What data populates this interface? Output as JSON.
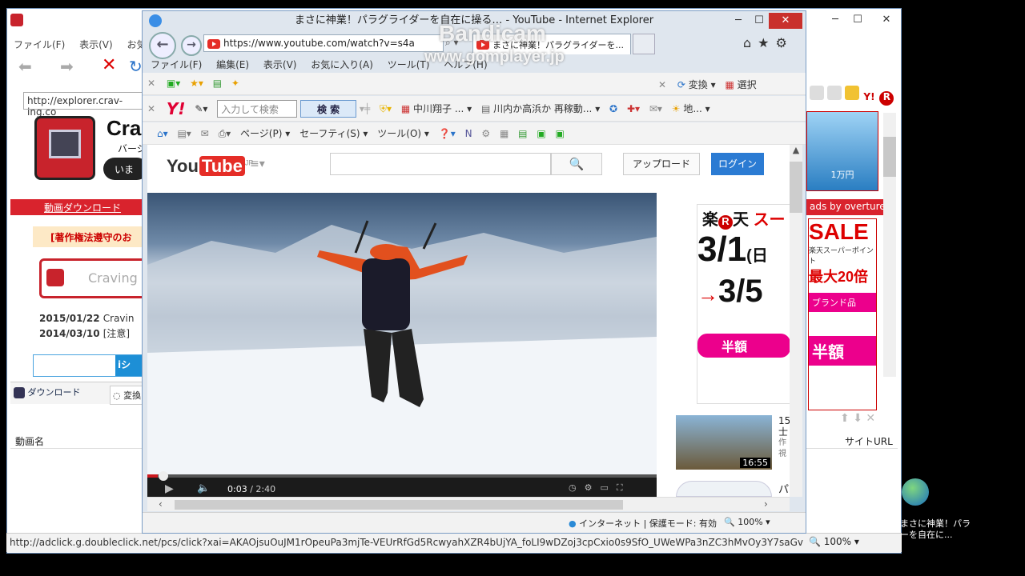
{
  "background_window": {
    "menu": [
      "ファイル(F)",
      "表示(V)",
      "お気に"
    ],
    "address": "http://explorer.crav-ing.co",
    "brand": "Cra",
    "subtext": "バージ",
    "pill": "いま",
    "download_bar": "動画ダウンロード",
    "copyright_notice": "[著作権法遵守のお",
    "craving_input": "Craving",
    "news": [
      {
        "date": "2015/01/22",
        "text": "Cravin"
      },
      {
        "date": "2014/03/10",
        "text": "[注意]"
      }
    ],
    "tabs": [
      "ダウンロード",
      "変換"
    ],
    "table_headers": [
      "動画名",
      "サイトURL"
    ],
    "ads_label": "ads by overture",
    "right_ad": {
      "big": "SALE",
      "sub": "楽天スーパーポイント",
      "max": "最大20倍",
      "brand": "ブランド品",
      "half": "半額"
    },
    "status_url": "http://adclick.g.doubleclick.net/pcs/click?xai=AKAOjsuOuJM1rOpeuPa3mjTe-VEUrRfGd5RcwyahXZR4bUjYA_foLI9wDZoj3cpCxio0s9SfO_UWeWPa3nZC3hMvOy3Y7saGvmK",
    "zoom": "100%"
  },
  "front_window": {
    "title": "まさに神業！パラグライダーを自在に操る… - YouTube - Internet Explorer",
    "address": "https://www.youtube.com/watch?v=s4a",
    "tab_title": "まさに神業！パラグライダーを...",
    "menu": [
      "ファイル(F)",
      "編集(E)",
      "表示(V)",
      "お気に入り(A)",
      "ツール(T)",
      "ヘルプ(H)"
    ],
    "toolbar1": {
      "convert": "変換",
      "select": "選択"
    },
    "toolbar2": {
      "search_placeholder": "入力して検索",
      "search_button": "検 索",
      "item1": "中川翔子 ...",
      "item2": "川内か高浜か 再稼動...",
      "item3": "地..."
    },
    "command_bar": {
      "page": "ページ(P)",
      "safety": "セーフティ(S)",
      "tools": "ツール(O)"
    },
    "youtube": {
      "logo_you": "You",
      "logo_tube": "Tube",
      "logo_region": "JP",
      "upload": "アップロード",
      "login": "ログイン",
      "current_time": "0:03",
      "duration": "2:40",
      "progress": 0.02
    },
    "ad": {
      "brand": "楽",
      "brand2": "天",
      "headline": "スー",
      "date1": "3/1",
      "date1_suffix": "(日",
      "date2": "3/5",
      "half": "半額"
    },
    "related": [
      {
        "num": "15",
        "title": "士",
        "meta1": "作",
        "meta2": "視",
        "time": "16:55"
      },
      {
        "num": "パ",
        "title": "",
        "meta1": "",
        "meta2": "",
        "time": ""
      }
    ],
    "status": {
      "zone": "インターネット | 保護モード: 有効",
      "zoom": "100%"
    }
  },
  "watermark": {
    "line1": "Bandicam",
    "line2": "www.gomplayer.jp"
  },
  "desktop_icon_label": "まさに神業！パラ\nーを自在に..."
}
